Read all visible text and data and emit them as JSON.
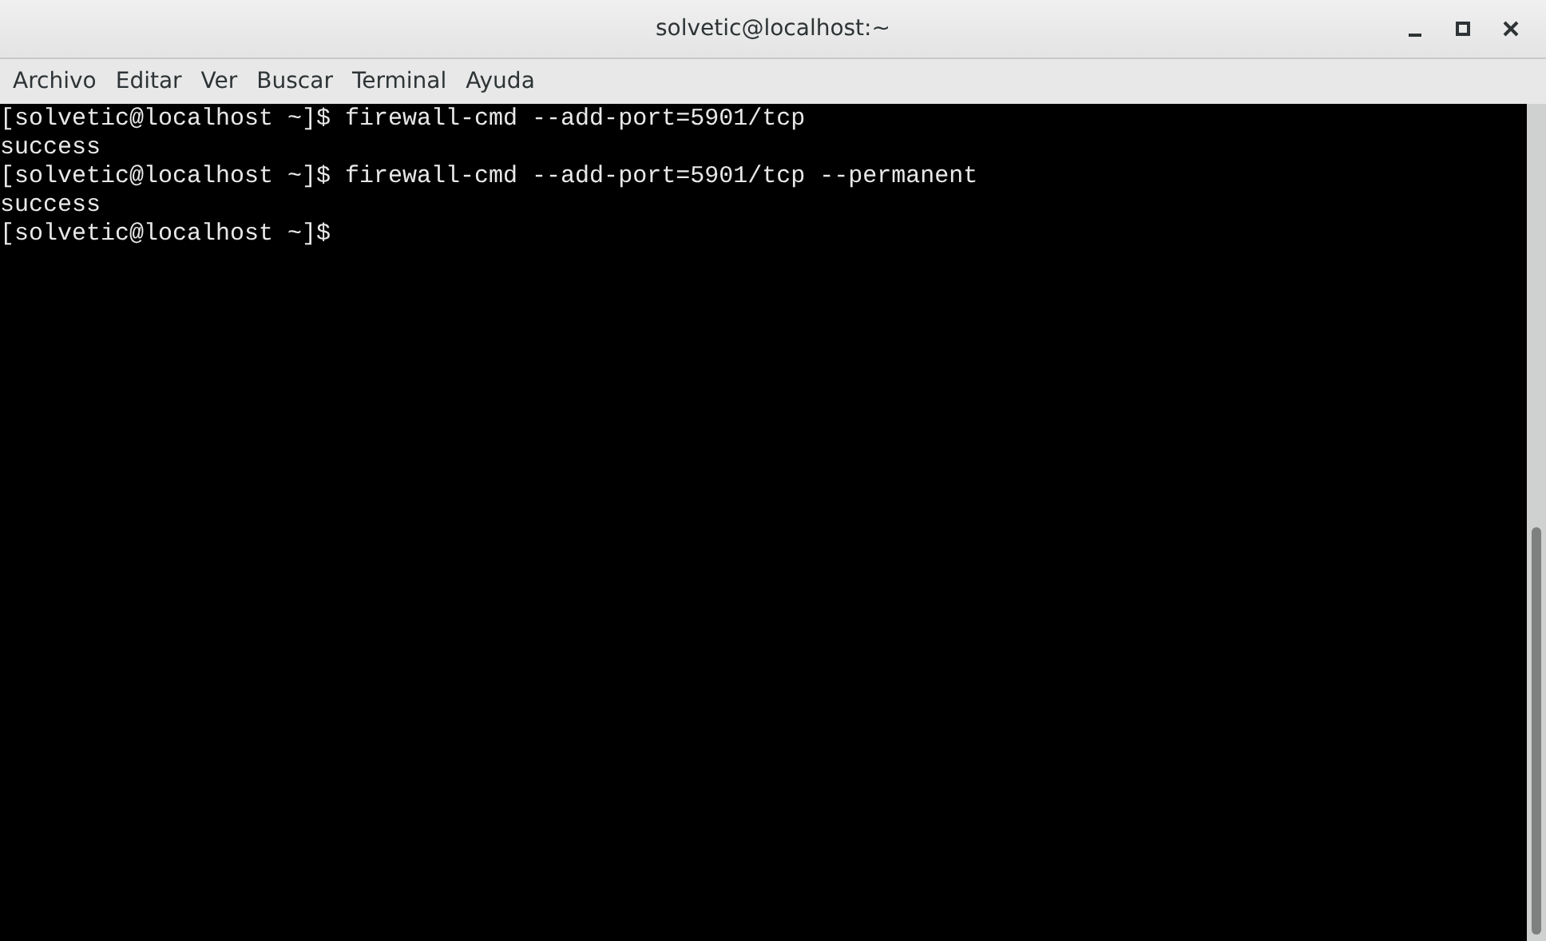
{
  "window": {
    "title": "solvetic@localhost:~"
  },
  "menu": [
    "Archivo",
    "Editar",
    "Ver",
    "Buscar",
    "Terminal",
    "Ayuda"
  ],
  "terminal": {
    "lines": [
      "[solvetic@localhost ~]$ firewall-cmd --add-port=5901/tcp",
      "success",
      "[solvetic@localhost ~]$ firewall-cmd --add-port=5901/tcp --permanent",
      "success",
      "[solvetic@localhost ~]$"
    ]
  }
}
